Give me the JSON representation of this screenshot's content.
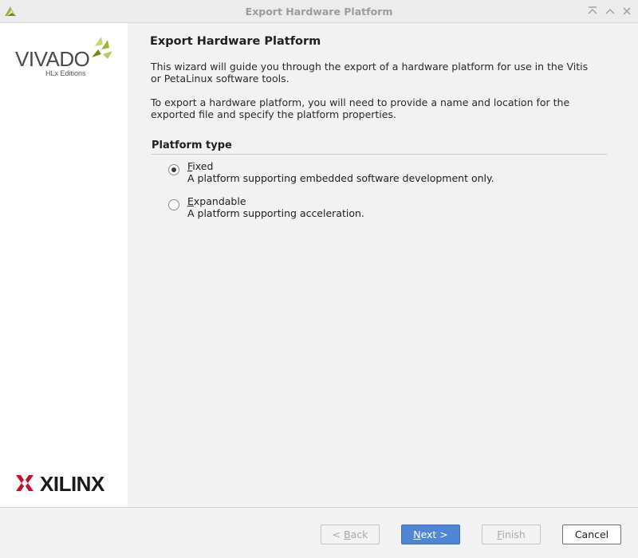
{
  "window": {
    "title": "Export Hardware Platform"
  },
  "sidebar": {
    "vivado_logo_text": "VIVADO",
    "vivado_sub": "HLx Editions",
    "xilinx_logo_text": "XILINX"
  },
  "main": {
    "heading": "Export Hardware Platform",
    "intro": "This wizard will guide you through the export of a hardware platform for use in the Vitis or PetaLinux software tools.",
    "instructions": "To export a hardware platform, you will need to provide a name and location for the exported file and specify the platform properties.",
    "platform_type": {
      "title": "Platform type",
      "options": [
        {
          "mnemonic": "F",
          "rest": "ixed",
          "description": "A platform supporting embedded software development only.",
          "selected": true
        },
        {
          "mnemonic": "E",
          "rest": "xpandable",
          "description": "A platform supporting acceleration.",
          "selected": false
        }
      ]
    }
  },
  "buttons": {
    "back": {
      "prefix": "< ",
      "mnemonic": "B",
      "rest": "ack"
    },
    "next": {
      "mnemonic": "N",
      "rest": "ext >"
    },
    "finish": {
      "mnemonic": "F",
      "rest": "inish"
    },
    "cancel": {
      "label": "Cancel"
    }
  },
  "icons": {
    "app": "vivado-leaf-icon",
    "minimize": "collapse-top-icon",
    "maximize": "chevron-up-icon",
    "close": "close-icon"
  },
  "colors": {
    "primary_button": "#4f86d6",
    "leaf_green": "#9cb53b",
    "xilinx_red": "#c8102e"
  }
}
